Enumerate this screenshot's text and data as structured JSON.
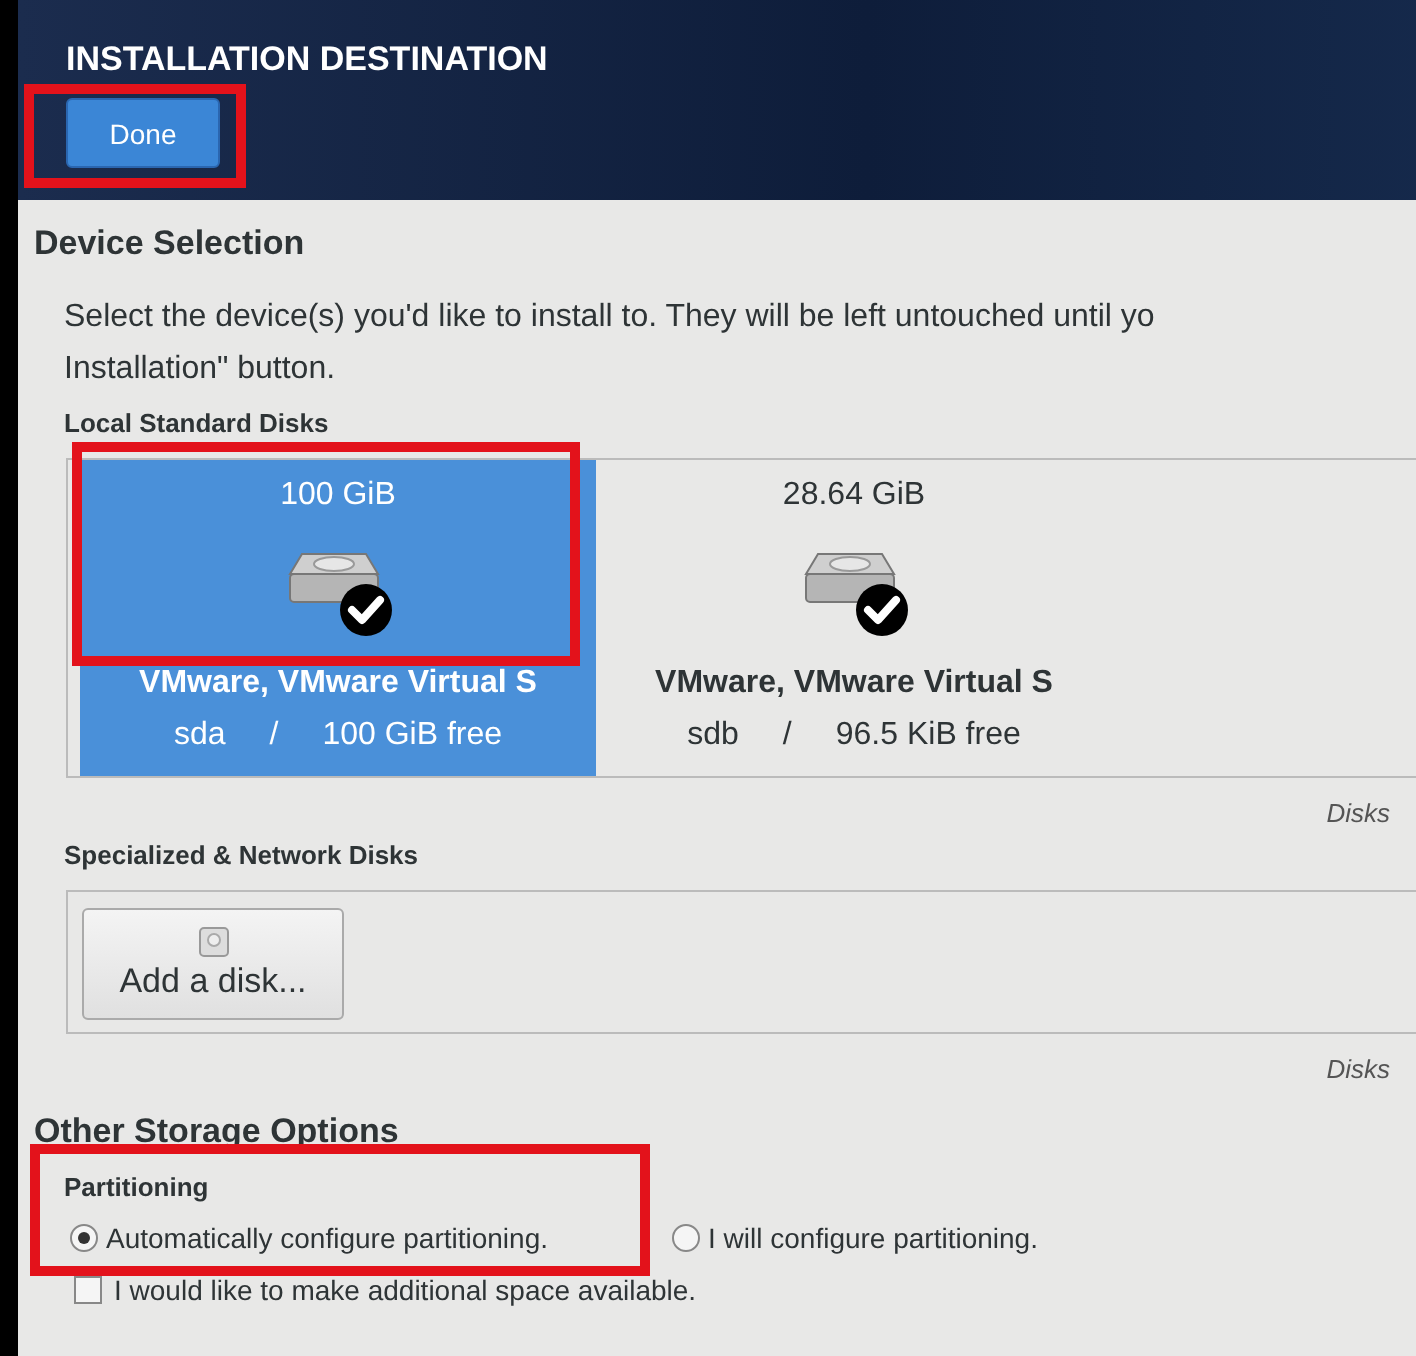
{
  "header": {
    "title": "INSTALLATION DESTINATION",
    "done_button": {
      "label": "Done",
      "highlighted": true
    }
  },
  "device_selection": {
    "heading": "Device Selection",
    "description": "Select the device(s) you'd like to install to.  They will be left untouched until yo",
    "description_line_2": "Installation\" button.",
    "local_disks": {
      "heading": "Local Standard Disks",
      "disks": [
        {
          "size": "100 GiB",
          "name": "VMware, VMware Virtual S",
          "device": "sda",
          "separator": "/",
          "free": "100 GiB free",
          "selected": true,
          "checked": true,
          "highlighted": true
        },
        {
          "size": "28.64 GiB",
          "name": "VMware, VMware Virtual S",
          "device": "sdb",
          "separator": "/",
          "free": "96.5 KiB free",
          "selected": false,
          "checked": true,
          "highlighted": false
        }
      ],
      "note": "Disks"
    },
    "network_disks": {
      "heading": "Specialized & Network Disks",
      "add_button": "Add a disk...",
      "note": "Disks"
    }
  },
  "other_storage": {
    "heading": "Other Storage Options",
    "partitioning": {
      "heading": "Partitioning",
      "highlighted": true,
      "options": [
        {
          "label": "Automatically configure partitioning.",
          "selected": true
        },
        {
          "label": "I will configure partitioning.",
          "selected": false
        }
      ]
    },
    "space_checkbox": {
      "label": "I would like to make additional space available.",
      "checked": false
    }
  }
}
